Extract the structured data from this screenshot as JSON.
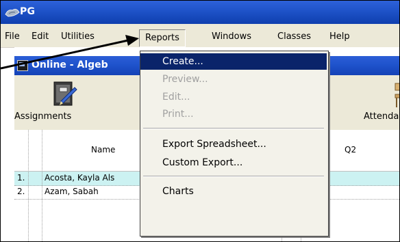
{
  "app": {
    "title": "PG"
  },
  "menubar": {
    "items": [
      {
        "label": "File"
      },
      {
        "label": "Edit"
      },
      {
        "label": "Utilities"
      },
      {
        "label": "Reports"
      },
      {
        "label": "Windows"
      },
      {
        "label": "Classes"
      },
      {
        "label": "Help"
      }
    ]
  },
  "child_window": {
    "title": "Online - Algeb"
  },
  "toolbar": {
    "assignments_label": "Assignments",
    "attendance_label": "Attenda"
  },
  "grid": {
    "headers": {
      "name": "Name",
      "q2": "Q2"
    },
    "rows": [
      {
        "num": "1.",
        "name": "Acosta, Kayla Als"
      },
      {
        "num": "2.",
        "name": "Azam, Sabah"
      }
    ]
  },
  "reports_menu": {
    "items": [
      {
        "label": "Create...",
        "state": "selected"
      },
      {
        "label": "Preview...",
        "state": "disabled"
      },
      {
        "label": "Edit...",
        "state": "disabled"
      },
      {
        "label": "Print...",
        "state": "disabled"
      },
      {
        "label": "Export Spreadsheet...",
        "state": "enabled"
      },
      {
        "label": "Custom Export...",
        "state": "enabled"
      },
      {
        "label": "Charts",
        "state": "enabled"
      }
    ]
  },
  "colors": {
    "titlebar": "#1e52c8",
    "menu_highlight": "#0a246a",
    "selected_row": "#ccf2f2"
  }
}
